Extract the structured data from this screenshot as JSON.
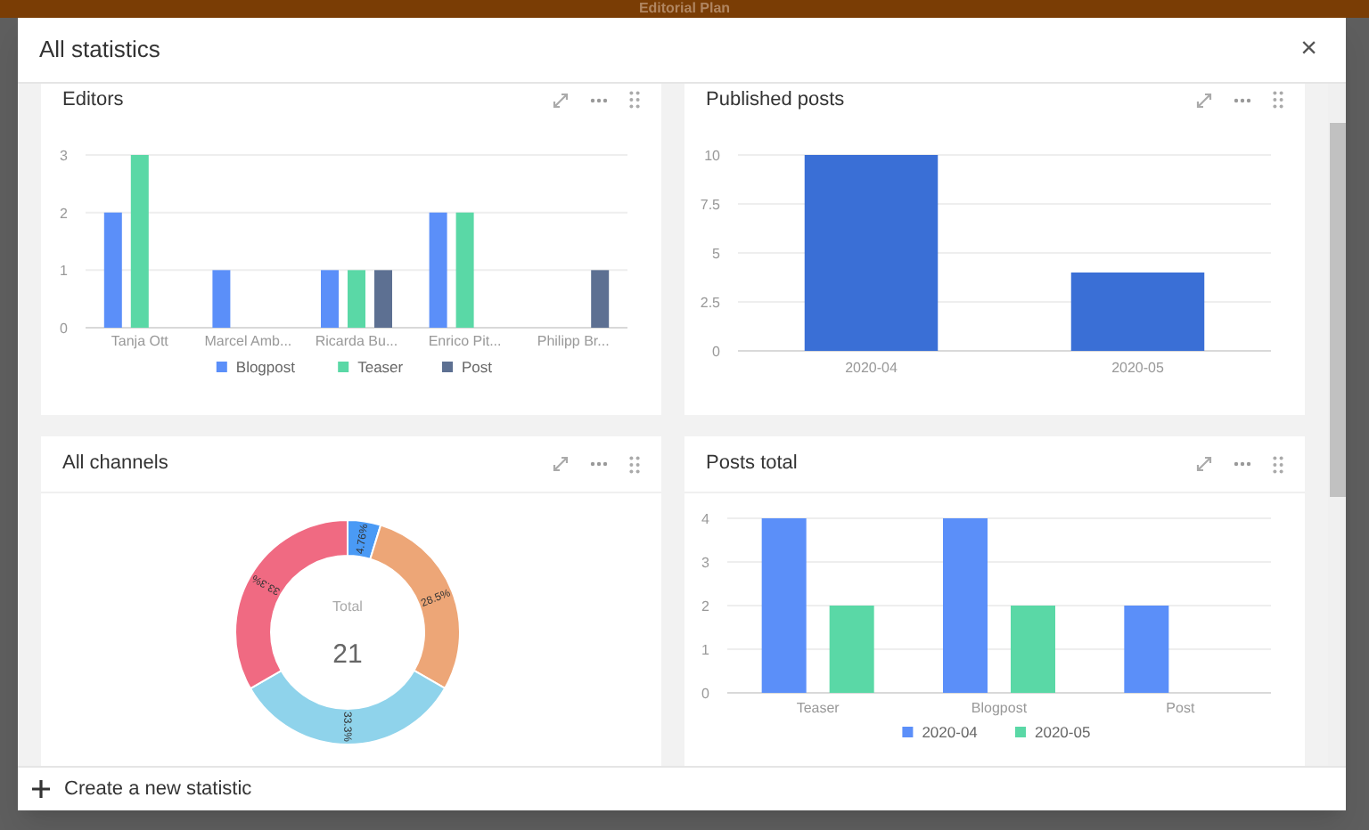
{
  "background": {
    "app_title": "Editorial Plan"
  },
  "dialog": {
    "title": "All statistics",
    "close": "×"
  },
  "cards": [
    {
      "title": "Editors",
      "chart_data": {
        "type": "bar",
        "categories": [
          "Tanja Ott",
          "Marcel Amb...",
          "Ricarda Bu...",
          "Enrico Pit...",
          "Philipp Br..."
        ],
        "series": [
          {
            "name": "Blogpost",
            "color": "#5b8ff9",
            "values": [
              2,
              1,
              1,
              2,
              0
            ]
          },
          {
            "name": "Teaser",
            "color": "#5ad8a6",
            "values": [
              3,
              0,
              1,
              2,
              0
            ]
          },
          {
            "name": "Post",
            "color": "#5d7092",
            "values": [
              0,
              0,
              1,
              0,
              1
            ]
          }
        ],
        "ylim": [
          0,
          3
        ],
        "yticks": [
          0,
          1,
          2,
          3
        ],
        "grid": true,
        "legend": true
      }
    },
    {
      "title": "Published posts",
      "chart_data": {
        "type": "bar",
        "categories": [
          "2020-04",
          "2020-05"
        ],
        "series": [
          {
            "color": "#3a6fd6",
            "values": [
              10,
              4
            ]
          }
        ],
        "ylim": [
          0,
          10
        ],
        "yticks": [
          0,
          2.5,
          5,
          7.5,
          10
        ],
        "grid": true
      }
    },
    {
      "title": "All channels",
      "center_label": "Total",
      "center_value": "21",
      "chart_data": {
        "type": "donut",
        "values": [
          4.76,
          28.5,
          33.3,
          33.3
        ],
        "colors": [
          "#4a9af5",
          "#eda677",
          "#8fd3eb",
          "#f06a82"
        ],
        "data_labels": true,
        "value_labels": [
          "4.76%",
          "28.5%",
          "33.3%",
          "33.3%"
        ]
      }
    },
    {
      "title": "Posts total",
      "chart_data": {
        "type": "bar",
        "categories": [
          "Teaser",
          "Blogpost",
          "Post"
        ],
        "series": [
          {
            "name": "2020-04",
            "color": "#5b8ff9",
            "values": [
              4,
              4,
              2
            ]
          },
          {
            "name": "2020-05",
            "color": "#5ad8a6",
            "values": [
              2,
              2,
              0
            ]
          }
        ],
        "ylim": [
          0,
          4
        ],
        "yticks": [
          0,
          1,
          2,
          3,
          4
        ],
        "grid": true,
        "legend": true
      }
    }
  ],
  "footer": {
    "button": "Create a new statistic"
  }
}
